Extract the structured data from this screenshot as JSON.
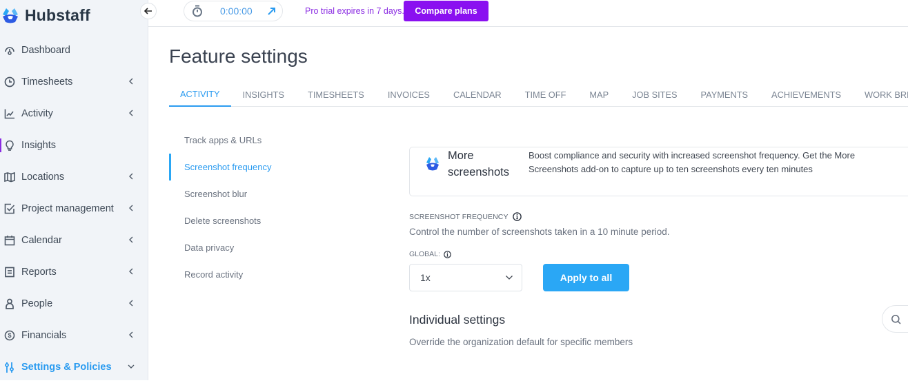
{
  "brand": {
    "name": "Hubstaff"
  },
  "topbar": {
    "timer_value": "0:00:00",
    "trial_text": "Pro trial expires in 7 days.",
    "compare_label": "Compare plans"
  },
  "sidebar": {
    "items": [
      {
        "label": "Dashboard",
        "icon": "dashboard-icon",
        "has_chevron": false
      },
      {
        "label": "Timesheets",
        "icon": "clock-icon",
        "has_chevron": true
      },
      {
        "label": "Activity",
        "icon": "activity-chart-icon",
        "has_chevron": true
      },
      {
        "label": "Insights",
        "icon": "lightbulb-icon",
        "has_chevron": false
      },
      {
        "label": "Locations",
        "icon": "map-icon",
        "has_chevron": true
      },
      {
        "label": "Project management",
        "icon": "checkbox-icon",
        "has_chevron": true
      },
      {
        "label": "Calendar",
        "icon": "calendar-icon",
        "has_chevron": true
      },
      {
        "label": "Reports",
        "icon": "report-icon",
        "has_chevron": true
      },
      {
        "label": "People",
        "icon": "person-icon",
        "has_chevron": true
      },
      {
        "label": "Financials",
        "icon": "dollar-icon",
        "has_chevron": true
      },
      {
        "label": "Settings & Policies",
        "icon": "sliders-icon",
        "has_chevron": true,
        "active": true
      }
    ]
  },
  "page": {
    "title": "Feature settings",
    "tabs": [
      "ACTIVITY",
      "INSIGHTS",
      "TIMESHEETS",
      "INVOICES",
      "CALENDAR",
      "TIME OFF",
      "MAP",
      "JOB SITES",
      "PAYMENTS",
      "ACHIEVEMENTS",
      "WORK BREAKS"
    ],
    "active_tab": "ACTIVITY",
    "subnav": [
      "Track apps & URLs",
      "Screenshot frequency",
      "Screenshot blur",
      "Delete screenshots",
      "Data privacy",
      "Record activity"
    ],
    "active_subnav": "Screenshot frequency"
  },
  "promo": {
    "title": "More screenshots",
    "description": "Boost compliance and security with increased screenshot frequency. Get the More Screenshots add-on to capture up to ten screenshots every ten minutes"
  },
  "frequency": {
    "section_label": "SCREENSHOT FREQUENCY",
    "description": "Control the number of screenshots taken in a 10 minute period.",
    "global_label": "GLOBAL:",
    "selected_value": "1x",
    "apply_label": "Apply to all"
  },
  "individual": {
    "title": "Individual settings",
    "description": "Override the organization default for specific members"
  },
  "colors": {
    "accent": "#2aa7f5",
    "brand_purple": "#8a10f0",
    "sidebar_bg": "#f1f4f8"
  }
}
